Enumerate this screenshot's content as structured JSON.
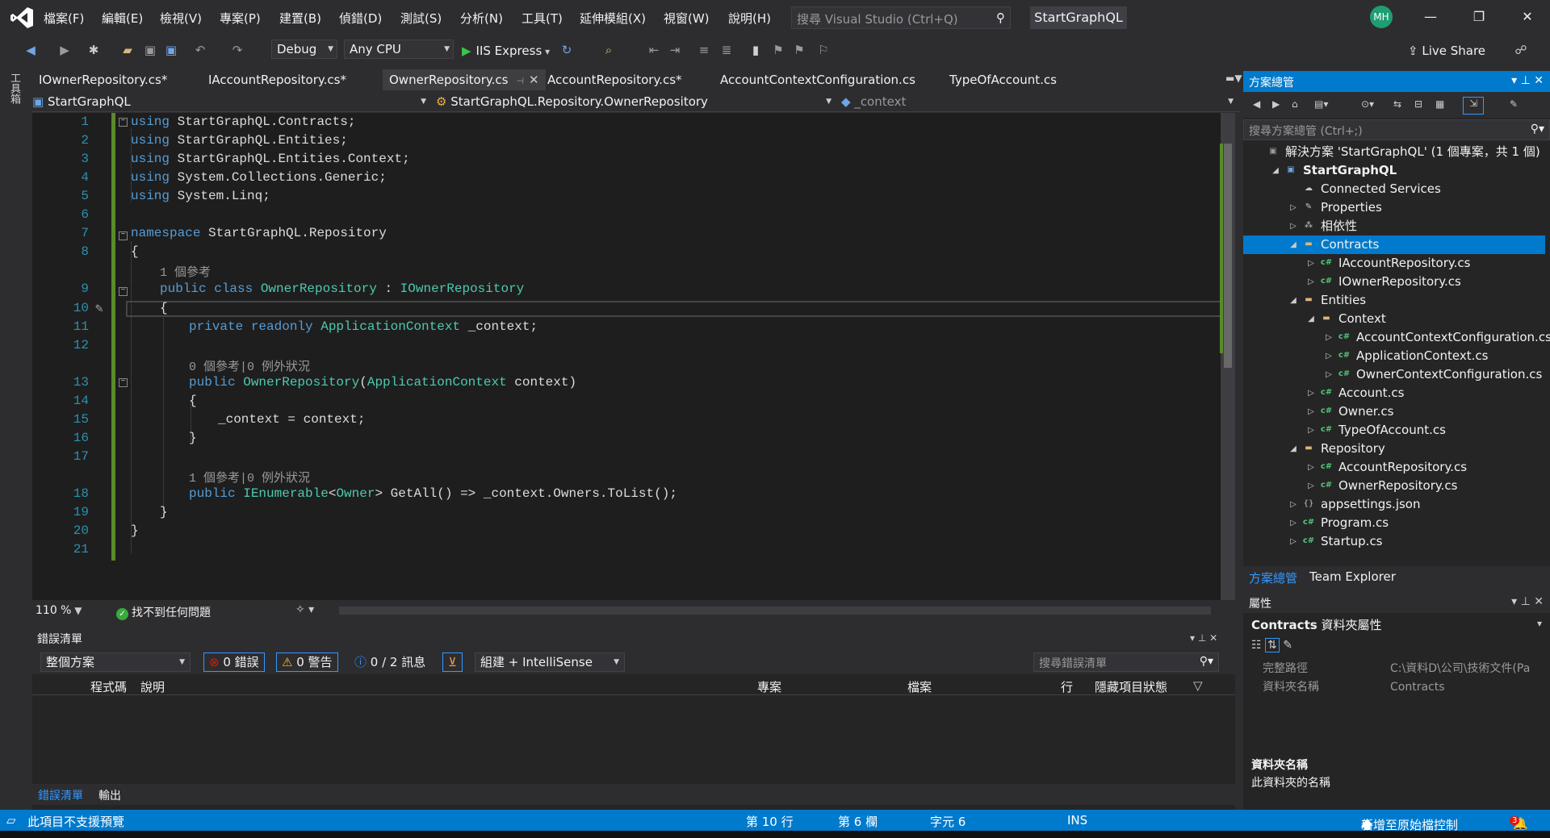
{
  "menubar": {
    "items": [
      "檔案(F)",
      "編輯(E)",
      "檢視(V)",
      "專案(P)",
      "建置(B)",
      "偵錯(D)",
      "測試(S)",
      "分析(N)",
      "工具(T)",
      "延伸模組(X)",
      "視窗(W)",
      "說明(H)"
    ],
    "search_placeholder": "搜尋 Visual Studio (Ctrl+Q)",
    "solution_name": "StartGraphQL",
    "avatar_initials": "MH"
  },
  "toolbar": {
    "configuration": "Debug",
    "platform": "Any CPU",
    "run_target": "IIS Express",
    "live_share": "Live Share"
  },
  "left_strip": {
    "label": "工具箱"
  },
  "tabs": [
    {
      "label": "IOwnerRepository.cs*",
      "active": false
    },
    {
      "label": "IAccountRepository.cs*",
      "active": false
    },
    {
      "label": "OwnerRepository.cs",
      "active": true
    },
    {
      "label": "AccountRepository.cs*",
      "active": false
    },
    {
      "label": "AccountContextConfiguration.cs",
      "active": false
    },
    {
      "label": "TypeOfAccount.cs",
      "active": false
    }
  ],
  "navbar": {
    "project": "StartGraphQL",
    "type": "StartGraphQL.Repository.OwnerRepository",
    "member": "_context"
  },
  "editor": {
    "line_numbers": [
      "1",
      "2",
      "3",
      "4",
      "5",
      "6",
      "7",
      "8",
      "9",
      "10",
      "11",
      "12",
      "13",
      "14",
      "15",
      "16",
      "17",
      "18",
      "19",
      "20",
      "21"
    ],
    "refs": {
      "r1": "1 個參考",
      "r2": "0 個參考|0 例外狀況",
      "r3": "1 個參考|0 例外狀況"
    },
    "code": {
      "l1": [
        "using",
        " StartGraphQL.Contracts;"
      ],
      "l2": [
        "using",
        " StartGraphQL.Entities;"
      ],
      "l3": [
        "using",
        " StartGraphQL.Entities.Context;"
      ],
      "l4": [
        "using",
        " System.Collections.Generic;"
      ],
      "l5": [
        "using",
        " System.Linq;"
      ],
      "l7": [
        "namespace",
        " StartGraphQL.Repository"
      ],
      "l8": "{",
      "l9": [
        "public class",
        " OwnerRepository",
        " : ",
        "IOwnerRepository"
      ],
      "l10": "{",
      "l11": [
        "private readonly",
        " ApplicationContext",
        " _context;"
      ],
      "l13": [
        "public",
        " OwnerRepository",
        "(",
        "ApplicationContext",
        " context)"
      ],
      "l14": "{",
      "l15": "_context = context;",
      "l16": "}",
      "l18": [
        "public",
        " IEnumerable",
        "<",
        "Owner",
        "> GetAll() => _context.Owners.ToList();"
      ],
      "l19": "}",
      "l20": "}"
    },
    "zoom": "110 %",
    "issues": "找不到任何問題"
  },
  "error_list": {
    "title": "錯誤清單",
    "scope": "整個方案",
    "errors": "0 錯誤",
    "warnings": "0 警告",
    "messages": "0 / 2 訊息",
    "build_filter": "組建 + IntelliSense",
    "search_placeholder": "搜尋錯誤清單",
    "columns": [
      "程式碼",
      "說明",
      "專案",
      "檔案",
      "行",
      "隱藏項目狀態"
    ],
    "bottom_tabs": [
      "錯誤清單",
      "輸出"
    ]
  },
  "solution_explorer": {
    "title": "方案總管",
    "search_placeholder": "搜尋方案總管 (Ctrl+;)",
    "tree": [
      {
        "label": "解決方案 'StartGraphQL' (1 個專案，共 1 個)",
        "indent": 0,
        "expander": "",
        "icon": "solution",
        "selected": false
      },
      {
        "label": "StartGraphQL",
        "indent": 1,
        "expander": "◢",
        "icon": "project",
        "selected": false,
        "bold": true
      },
      {
        "label": "Connected Services",
        "indent": 2,
        "expander": "",
        "icon": "cloud",
        "selected": false
      },
      {
        "label": "Properties",
        "indent": 2,
        "expander": "▷",
        "icon": "wrench",
        "selected": false
      },
      {
        "label": "相依性",
        "indent": 2,
        "expander": "▷",
        "icon": "deps",
        "selected": false
      },
      {
        "label": "Contracts",
        "indent": 2,
        "expander": "◢",
        "icon": "folder",
        "selected": true
      },
      {
        "label": "IAccountRepository.cs",
        "indent": 3,
        "expander": "▷",
        "icon": "cs",
        "selected": false
      },
      {
        "label": "IOwnerRepository.cs",
        "indent": 3,
        "expander": "▷",
        "icon": "cs",
        "selected": false
      },
      {
        "label": "Entities",
        "indent": 2,
        "expander": "◢",
        "icon": "folder",
        "selected": false
      },
      {
        "label": "Context",
        "indent": 3,
        "expander": "◢",
        "icon": "folder",
        "selected": false
      },
      {
        "label": "AccountContextConfiguration.cs",
        "indent": 4,
        "expander": "▷",
        "icon": "cs",
        "selected": false
      },
      {
        "label": "ApplicationContext.cs",
        "indent": 4,
        "expander": "▷",
        "icon": "cs",
        "selected": false
      },
      {
        "label": "OwnerContextConfiguration.cs",
        "indent": 4,
        "expander": "▷",
        "icon": "cs",
        "selected": false
      },
      {
        "label": "Account.cs",
        "indent": 3,
        "expander": "▷",
        "icon": "cs",
        "selected": false
      },
      {
        "label": "Owner.cs",
        "indent": 3,
        "expander": "▷",
        "icon": "cs",
        "selected": false
      },
      {
        "label": "TypeOfAccount.cs",
        "indent": 3,
        "expander": "▷",
        "icon": "cs",
        "selected": false
      },
      {
        "label": "Repository",
        "indent": 2,
        "expander": "◢",
        "icon": "folder",
        "selected": false
      },
      {
        "label": "AccountRepository.cs",
        "indent": 3,
        "expander": "▷",
        "icon": "cs",
        "selected": false
      },
      {
        "label": "OwnerRepository.cs",
        "indent": 3,
        "expander": "▷",
        "icon": "cs",
        "selected": false
      },
      {
        "label": "appsettings.json",
        "indent": 2,
        "expander": "▷",
        "icon": "json",
        "selected": false
      },
      {
        "label": "Program.cs",
        "indent": 2,
        "expander": "▷",
        "icon": "cs",
        "selected": false
      },
      {
        "label": "Startup.cs",
        "indent": 2,
        "expander": "▷",
        "icon": "cs",
        "selected": false
      }
    ],
    "tabs": [
      "方案總管",
      "Team Explorer"
    ]
  },
  "properties": {
    "title": "屬性",
    "object_name": "Contracts",
    "object_type": "資料夾屬性",
    "rows": [
      {
        "name": "完整路徑",
        "value": "C:\\資料D\\公司\\技術文件(Pa"
      },
      {
        "name": "資料夾名稱",
        "value": "Contracts"
      }
    ],
    "desc_title": "資料夾名稱",
    "desc_text": "此資料夾的名稱"
  },
  "statusbar": {
    "message": "此項目不支援預覽",
    "line": "第 10 行",
    "col": "第 6 欄",
    "char": "字元 6",
    "mode": "INS",
    "source_control": "新增至原始檔控制",
    "notifications": "3"
  },
  "colors": {
    "accent": "#007acc",
    "keyword": "#569cd6",
    "type": "#4ec9b0",
    "line_number": "#2b91af"
  }
}
